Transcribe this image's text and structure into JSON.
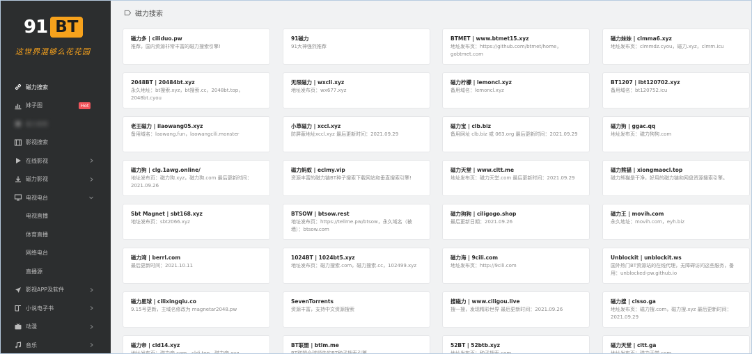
{
  "logo": {
    "num": "91",
    "bt": "BT",
    "slogan": "这世界混够么花花园"
  },
  "section": {
    "title": "磁力搜索"
  },
  "sidebar": {
    "items": [
      {
        "label": "磁力搜索",
        "icon": "link-icon",
        "active": true
      },
      {
        "label": "妹子图",
        "icon": "chart-icon",
        "badge": "Hot"
      },
      {
        "label": "磁力搜索",
        "icon": "blurred-icon",
        "blurred": true
      },
      {
        "label": "影视搜索",
        "icon": "film-icon"
      },
      {
        "label": "在线影视",
        "icon": "play-icon",
        "chevron": "right"
      },
      {
        "label": "磁力影视",
        "icon": "download-icon",
        "chevron": "right"
      },
      {
        "label": "电视电台",
        "icon": "monitor-icon",
        "chevron": "down"
      },
      {
        "label": "电视直播",
        "sub": true
      },
      {
        "label": "体育直播",
        "sub": true
      },
      {
        "label": "网络电台",
        "sub": true
      },
      {
        "label": "直播源",
        "sub": true
      },
      {
        "label": "影视APP及软件",
        "icon": "rocket-icon",
        "chevron": "right"
      },
      {
        "label": "小说电子书",
        "icon": "book-icon",
        "chevron": "right"
      },
      {
        "label": "动漫",
        "icon": "tv-icon",
        "chevron": "right"
      },
      {
        "label": "音乐",
        "icon": "music-icon",
        "chevron": "right"
      }
    ]
  },
  "cards": [
    {
      "title": "磁力多 | ciliduo.pw",
      "desc": "推荐，国内资源非常丰富的磁力搜索引擎!"
    },
    {
      "title": "91磁力",
      "desc": "91大神强烈推荐"
    },
    {
      "title": "BTMET | www.btmet15.xyz",
      "desc": "地址发布页：https://github.com/btmet/home，gobtmet.com"
    },
    {
      "title": "磁力妹妹 | clmma6.xyz",
      "desc": "地址发布页：clmmdz.cyou，磁力.xyz，clmm.icu"
    },
    {
      "title": "2048BT | 20484bt.xyz",
      "desc": "永久地址：bt搜索.xyz，bt搜索.cc，2048bt.top，2048bt.cyou"
    },
    {
      "title": "无限磁力 | wxcli.xyz",
      "desc": "地址发布页：wx677.xyz"
    },
    {
      "title": "磁力柠檬 | lemoncl.xyz",
      "desc": "备用域名：lemoncl.xyz"
    },
    {
      "title": "BT1207 | ibt120702.xyz",
      "desc": "备用域名：bt120752.icu"
    },
    {
      "title": "老王磁力 | ilaowang05.xyz",
      "desc": "备用域名：laowang.fun，laowangcili.monster"
    },
    {
      "title": "小草磁力 | xccl.xyz",
      "desc": "防屏蔽地址xccl.xyz 最后更新时间：2021.09.29"
    },
    {
      "title": "磁力宝 | clb.biz",
      "desc": "备用网址 clb.biz 或 063.org 最后更新时间：2021.09.29"
    },
    {
      "title": "磁力狗 | ggac.qq",
      "desc": "地址发布页：磁力狗狗.com"
    },
    {
      "title": "磁力狗 | clg.1awg.online/",
      "desc": "地址发布页：磁力狗.xyz，磁力狗.com 最后更新时间：2021.09.26"
    },
    {
      "title": "磁力蚂蚁 | eclmy.vip",
      "desc": "资源丰富的磁力链BT种子搜索下载网站和垂直搜索引擎!"
    },
    {
      "title": "磁力天堂 | www.cltt.me",
      "desc": "地址发布页：磁力天堂.com 最后更新时间：2021.09.29"
    },
    {
      "title": "磁力熊猫 | xiongmaocl.top",
      "desc": "磁力熊猫是干净，好用的磁力链和网盘资源搜索引擎。"
    },
    {
      "title": "Sbt Magnet | sbt168.xyz",
      "desc": "地址发布页：sbt2066.xyz"
    },
    {
      "title": "BTSOW | btsow.rest",
      "desc": "地址发布页：https://tellme.pw/btsow，永久域名（被墙）：btsow.com"
    },
    {
      "title": "磁力狗狗 | ciligogo.shop",
      "desc": "最后更新日期：2021.09.26"
    },
    {
      "title": "磁力王 | movih.com",
      "desc": "永久地址：movih.com，eyh.biz"
    },
    {
      "title": "磁力湾 | berrl.com",
      "desc": "最后更新时间：2021.10.11"
    },
    {
      "title": "1024BT | 1024bt5.xyz",
      "desc": "地址发布页：磁力搜索.com，磁力搜索.cc，102499.xyz"
    },
    {
      "title": "磁力海 | 9cili.com",
      "desc": "地址发布页：http://9cili.com"
    },
    {
      "title": "Unblockit | unblockit.ws",
      "desc": "国外热门BT资源站的在线代理，无障碍访问这些服务，备用：unblocked-pw.github.io"
    },
    {
      "title": "磁力星球 | cilixingqiu.co",
      "desc": "9.15号更新，主域名修改为 magnetar2048.pw"
    },
    {
      "title": "SevenTorrents",
      "desc": "资源丰富，支持中文资源搜索"
    },
    {
      "title": "搜磁力 | www.ciligou.live",
      "desc": "搜一搜，发现精彩世界 最后更新时间：2021.09.26"
    },
    {
      "title": "磁力搜 | clsso.ga",
      "desc": "地址发布页：磁力搜.com，磁力搜.xyz 最后更新时间：2021.09.29"
    },
    {
      "title": "磁力帝 | cld14.xyz",
      "desc": "地址发布页：磁力帝.com，cldi.top，磁力帝.xyz"
    },
    {
      "title": "BT联盟 | btlm.me",
      "desc": "BT联盟全球领先的BT种子搜索引擎"
    },
    {
      "title": "52BT | 52btb.xyz",
      "desc": "地址发布页：种子搜索.com"
    },
    {
      "title": "磁力天堂 | cltt.ga",
      "desc": "地址发布页：磁力天堂.com"
    }
  ]
}
